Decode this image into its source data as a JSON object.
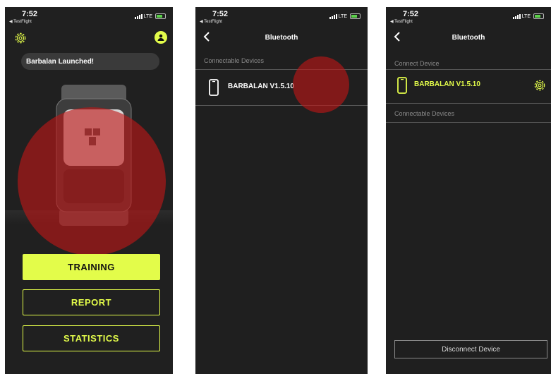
{
  "colors": {
    "accent": "#e3fc4a",
    "background": "#202020",
    "overlay": "#be1616",
    "muted": "#8a8a8a"
  },
  "status_bar": {
    "time": "7:52",
    "back_app": "◀ TestFlight",
    "network": "LTE"
  },
  "home": {
    "toast": "Barbalan Launched!",
    "buttons": {
      "training": "TRAINING",
      "report": "REPORT",
      "statistics": "STATISTICS"
    },
    "icons": {
      "settings": "gear-icon",
      "profile": "user-icon"
    }
  },
  "bluetooth_scan": {
    "title": "Bluetooth",
    "section_connectable": "Connectable Devices",
    "device_name": "BARBALAN V1.5.10"
  },
  "bluetooth_connected": {
    "title": "Bluetooth",
    "section_connected": "Connect Device",
    "device_name": "BARBALAN V1.5.10",
    "section_connectable": "Connectable Devices",
    "disconnect_label": "Disconnect Device"
  }
}
